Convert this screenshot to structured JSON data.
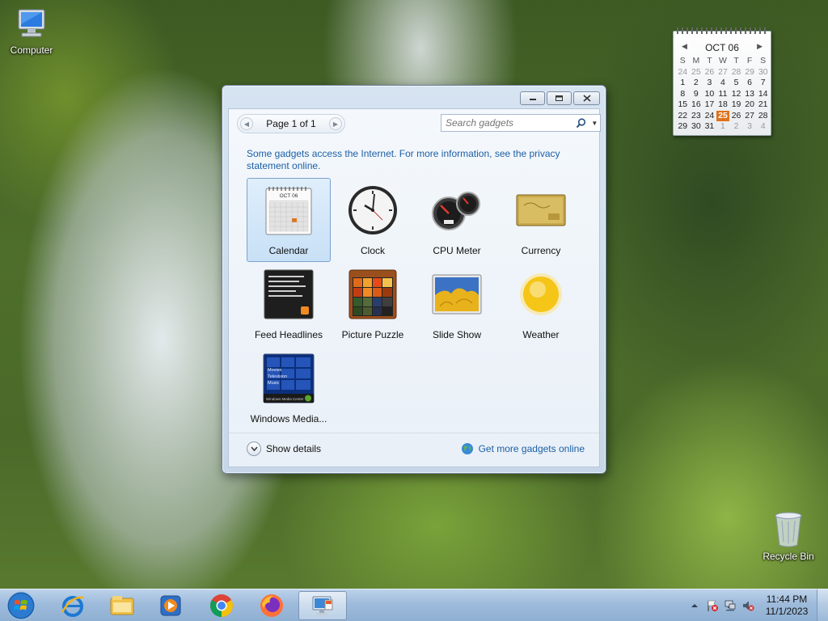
{
  "desktop": {
    "icons": [
      {
        "label": "Computer"
      },
      {
        "label": "Recycle Bin"
      }
    ]
  },
  "calendar_gadget": {
    "month": "OCT 06",
    "weekdays": [
      "S",
      "M",
      "T",
      "W",
      "T",
      "F",
      "S"
    ],
    "weeks": [
      [
        "24",
        "25",
        "26",
        "27",
        "28",
        "29",
        "30"
      ],
      [
        "1",
        "2",
        "3",
        "4",
        "5",
        "6",
        "7"
      ],
      [
        "8",
        "9",
        "10",
        "11",
        "12",
        "13",
        "14"
      ],
      [
        "15",
        "16",
        "17",
        "18",
        "19",
        "20",
        "21"
      ],
      [
        "22",
        "23",
        "24",
        "25",
        "26",
        "27",
        "28"
      ],
      [
        "29",
        "30",
        "31",
        "1",
        "2",
        "3",
        "4"
      ]
    ],
    "today": "25",
    "accent_color": "#e0721a"
  },
  "gadget_window": {
    "pager": {
      "label": "Page 1 of 1"
    },
    "search": {
      "placeholder": "Search gadgets"
    },
    "notice": "Some gadgets access the Internet.  For more information, see the privacy statement online.",
    "gadgets": [
      {
        "name": "Calendar",
        "icon": "calendar-gadget-icon",
        "selected": true
      },
      {
        "name": "Clock",
        "icon": "clock-gadget-icon"
      },
      {
        "name": "CPU Meter",
        "icon": "cpu-meter-gadget-icon"
      },
      {
        "name": "Currency",
        "icon": "currency-gadget-icon"
      },
      {
        "name": "Feed Headlines",
        "icon": "feed-headlines-gadget-icon"
      },
      {
        "name": "Picture Puzzle",
        "icon": "picture-puzzle-gadget-icon"
      },
      {
        "name": "Slide Show",
        "icon": "slide-show-gadget-icon"
      },
      {
        "name": "Weather",
        "icon": "weather-gadget-icon"
      },
      {
        "name": "Windows Media...",
        "icon": "windows-media-center-gadget-icon"
      }
    ],
    "thumbnails": {
      "calendar_month": "OCT 06",
      "media_center_items": [
        "Movies",
        "Television",
        "Music"
      ],
      "media_center_footer": "Windows Media Center"
    },
    "footer": {
      "show_details": "Show details",
      "get_more": "Get more gadgets online"
    }
  },
  "taskbar": {
    "pinned": [
      {
        "icon": "internet-explorer-icon"
      },
      {
        "icon": "file-explorer-icon"
      },
      {
        "icon": "media-player-icon"
      },
      {
        "icon": "chrome-icon"
      },
      {
        "icon": "firefox-icon"
      },
      {
        "icon": "gadgets-icon",
        "active": true
      }
    ],
    "tray": {
      "time": "11:44 PM",
      "date": "11/1/2023"
    }
  }
}
